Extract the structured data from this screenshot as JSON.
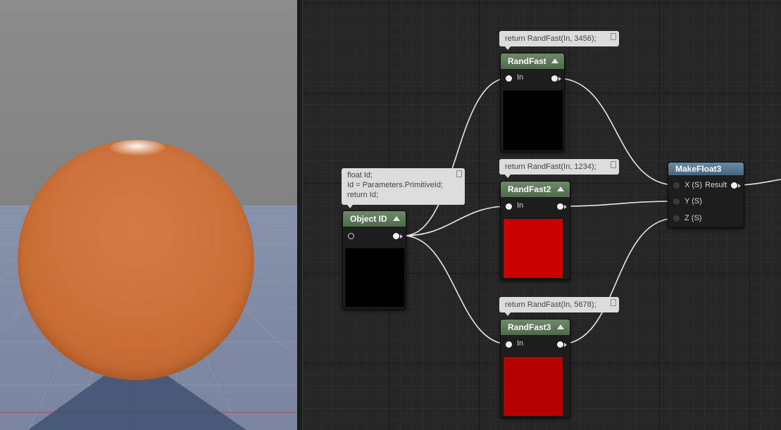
{
  "viewport": {
    "background_color": "#8a8a8a",
    "floor_color": "#8590aa",
    "sphere_color": "#cc7038"
  },
  "graph": {
    "nodes": {
      "object_id": {
        "title": "Object ID",
        "comment": [
          "float Id;",
          "Id = Parameters.PrimitiveId;",
          "return Id;"
        ],
        "preview_color": "#000000"
      },
      "rand_fast": {
        "title": "RandFast",
        "input_label": "In",
        "comment": "return RandFast(In, 3456);",
        "preview_color": "#000000"
      },
      "rand_fast2": {
        "title": "RandFast2",
        "input_label": "In",
        "comment": "return RandFast(In, 1234);",
        "preview_color": "#c80000"
      },
      "rand_fast3": {
        "title": "RandFast3",
        "input_label": "In",
        "comment": "return RandFast(In, 5678);",
        "preview_color": "#b40000"
      },
      "make_float3": {
        "title": "MakeFloat3",
        "inputs": [
          "X (S)",
          "Y (S)",
          "Z (S)"
        ],
        "output_label": "Result"
      }
    },
    "colors": {
      "wire": "#e6e6e6",
      "header_green": "#5b7657",
      "header_blue": "#56748e"
    }
  }
}
